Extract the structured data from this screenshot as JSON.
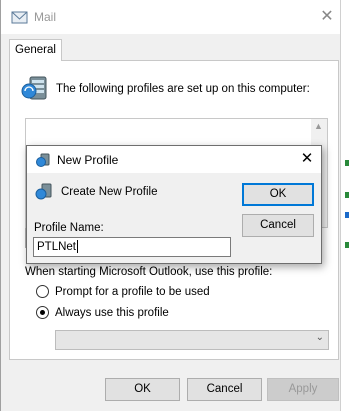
{
  "mail_window": {
    "title": "Mail",
    "close_glyph": "✕",
    "tab_label": "General",
    "profiles_prompt": "The following profiles are set up on this computer:",
    "startup_label": "When starting Microsoft Outlook, use this profile:",
    "radio_options": [
      {
        "label": "Prompt for a profile to be used",
        "checked": false
      },
      {
        "label": "Always use this profile",
        "checked": true
      }
    ],
    "profile_select_value": "",
    "buttons": {
      "ok": "OK",
      "cancel": "Cancel",
      "apply": "Apply"
    }
  },
  "new_profile_dialog": {
    "title": "New Profile",
    "close_glyph": "✕",
    "create_text": "Create New Profile",
    "name_label": "Profile Name:",
    "name_value": "PTLNet",
    "ok_label": "OK",
    "cancel_label": "Cancel"
  },
  "icons": {
    "mail_app": "mail-icon",
    "profiles": "profiles-icon",
    "new_profile": "profile-icon"
  },
  "colors": {
    "accent": "#0078d7",
    "dialog_bg": "#f0f0f0",
    "button_bg": "#e1e1e1"
  }
}
